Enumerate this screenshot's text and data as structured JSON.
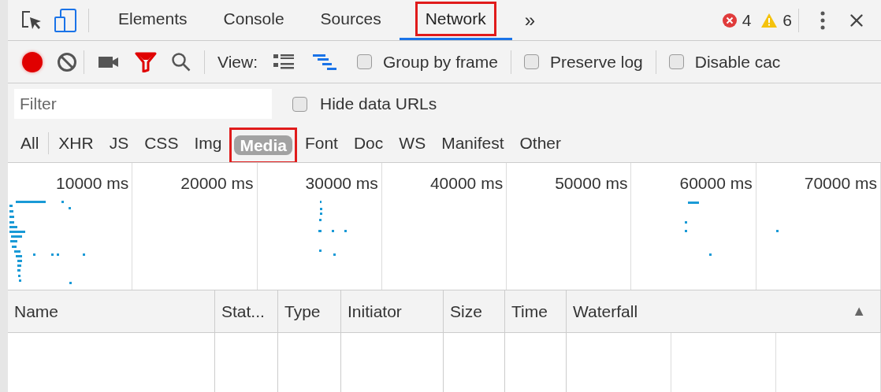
{
  "panel_tabs": [
    {
      "label": "Elements",
      "selected": false,
      "highlighted": false
    },
    {
      "label": "Console",
      "selected": false,
      "highlighted": false
    },
    {
      "label": "Sources",
      "selected": false,
      "highlighted": false
    },
    {
      "label": "Network",
      "selected": true,
      "highlighted": true
    }
  ],
  "more_tabs": "»",
  "error_count": "4",
  "warning_count": "6",
  "network_toolbar": {
    "recording": true,
    "view_label": "View:",
    "options": [
      {
        "label": "Group by frame",
        "checked": false
      },
      {
        "label": "Preserve log",
        "checked": false
      },
      {
        "label": "Disable cac",
        "checked": false
      }
    ]
  },
  "filter": {
    "placeholder": "Filter",
    "hide_data_urls": {
      "label": "Hide data URLs",
      "checked": false
    }
  },
  "type_filters": [
    {
      "label": "All",
      "selected": false,
      "highlighted": false
    },
    {
      "label": "XHR",
      "selected": false,
      "highlighted": false
    },
    {
      "label": "JS",
      "selected": false,
      "highlighted": false
    },
    {
      "label": "CSS",
      "selected": false,
      "highlighted": false
    },
    {
      "label": "Img",
      "selected": false,
      "highlighted": false
    },
    {
      "label": "Media",
      "selected": true,
      "highlighted": true
    },
    {
      "label": "Font",
      "selected": false,
      "highlighted": false
    },
    {
      "label": "Doc",
      "selected": false,
      "highlighted": false
    },
    {
      "label": "WS",
      "selected": false,
      "highlighted": false
    },
    {
      "label": "Manifest",
      "selected": false,
      "highlighted": false
    },
    {
      "label": "Other",
      "selected": false,
      "highlighted": false
    }
  ],
  "overview": {
    "ticks": [
      "10000 ms",
      "20000 ms",
      "30000 ms",
      "40000 ms",
      "50000 ms",
      "60000 ms",
      "70000 ms"
    ]
  },
  "table": {
    "columns": [
      "Name",
      "Stat...",
      "Type",
      "Initiator",
      "Size",
      "Time",
      "Waterfall"
    ],
    "sort_indicator": "▲"
  }
}
